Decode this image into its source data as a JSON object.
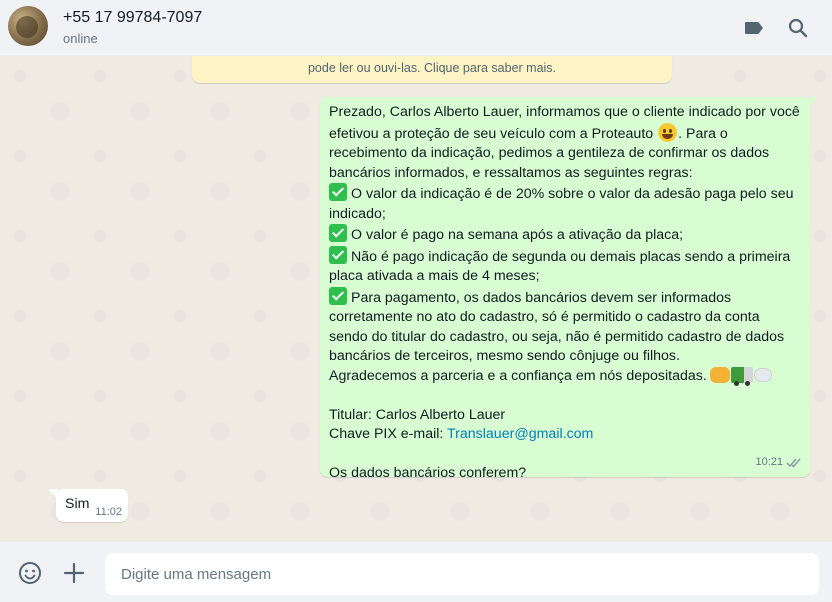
{
  "header": {
    "contact_name": "+55 17 99784-7097",
    "status": "online",
    "icons": [
      "label-icon",
      "search-icon"
    ]
  },
  "chat": {
    "encryption_notice": "pode ler ou ouvi-las. Clique para saber mais.",
    "outgoing": {
      "lines": {
        "l1": "Prezado, Carlos Alberto Lauer, informamos que o cliente indicado por você",
        "l2a": "efetivou a proteção de seu veículo com a Proteauto",
        "l2b": ". Para o",
        "l3": "recebimento da indicação, pedimos a gentileza de confirmar os dados",
        "l4": "bancários informados, e  ressaltamos as seguintes regras:",
        "l5": "O valor da indicação é de 20% sobre o valor da adesão paga pelo seu",
        "l6": "indicado;",
        "l7": "O valor é pago na semana após a ativação da placa;",
        "l8": "Não é pago indicação de segunda ou demais placas sendo a primeira",
        "l9": "placa ativada a mais de 4 meses;",
        "l10": "Para pagamento, os dados bancários devem ser informados",
        "l11": "corretamente no ato do cadastro, só é permitido o cadastro da conta",
        "l12": "sendo do titular do cadastro, ou seja, não é permitido cadastro de dados",
        "l13": "bancários de terceiros, mesmo sendo cônjuge ou filhos.",
        "l14": "Agradecemos a parceria e a confiança em nós depositadas.",
        "l15": "Titular: Carlos Alberto Lauer",
        "l16a": "Chave PIX e-mail: ",
        "l16b": "Translauer@gmail.com",
        "l17": "Os dados bancários conferem?"
      },
      "time": "10:21",
      "status_icon": "double-check-icon"
    },
    "incoming": {
      "text": "Sim",
      "time": "11:02"
    }
  },
  "footer": {
    "placeholder": "Digite uma mensagem",
    "icons": [
      "emoji-icon",
      "plus-icon"
    ]
  },
  "colors": {
    "outgoing_bubble": "#d9fdd3",
    "incoming_bubble": "#ffffff",
    "chat_background": "#efeae2",
    "header_background": "#f0f2f5",
    "link": "#027eb5"
  }
}
